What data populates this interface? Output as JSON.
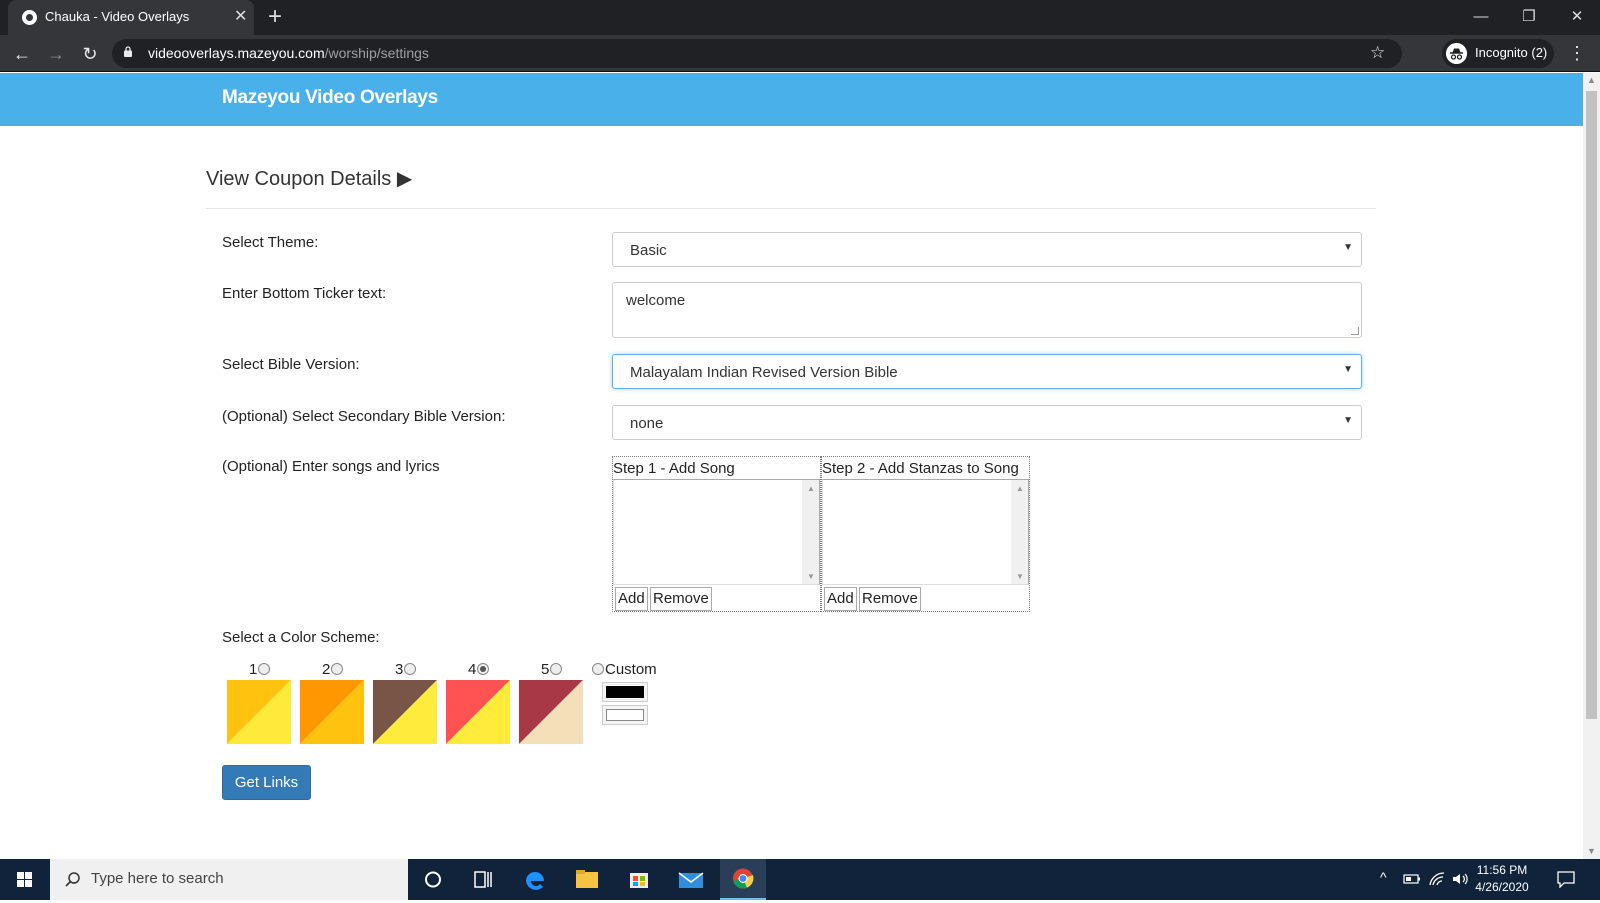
{
  "browser": {
    "tab_title": "Chauka - Video Overlays",
    "url_host": "videooverlays.mazeyou.com",
    "url_path": "/worship/settings",
    "profile_label": "Incognito (2)"
  },
  "page": {
    "brand": "Mazeyou Video Overlays",
    "coupon_link": "View Coupon Details",
    "coupon_arrow": "▶",
    "form": {
      "theme_label": "Select Theme:",
      "theme_value": "Basic",
      "ticker_label": "Enter Bottom Ticker text:",
      "ticker_value": "welcome",
      "bible_label": "Select Bible Version:",
      "bible_value": "Malayalam Indian Revised Version Bible",
      "secondary_label": "(Optional) Select Secondary Bible Version:",
      "secondary_value": "none",
      "songs_label": "(Optional) Enter songs and lyrics",
      "step1_caption": "Step 1 - Add Song",
      "step2_caption": "Step 2 - Add Stanzas to Song",
      "add_label": "Add",
      "remove_label": "Remove",
      "color_label": "Select a Color Scheme:",
      "schemes": [
        {
          "label": "1",
          "selected": false,
          "colors": [
            "#ffc20e",
            "#ffe93b"
          ]
        },
        {
          "label": "2",
          "selected": false,
          "colors": [
            "#ff9800",
            "#ffc20e"
          ]
        },
        {
          "label": "3",
          "selected": false,
          "colors": [
            "#795548",
            "#ffeb3b"
          ]
        },
        {
          "label": "4",
          "selected": true,
          "colors": [
            "#ff5252",
            "#ffeb3b"
          ]
        },
        {
          "label": "5",
          "selected": false,
          "colors": [
            "#a83845",
            "#f5dfb8"
          ]
        }
      ],
      "custom_label": "Custom",
      "custom_colors": [
        "#000000",
        "#ffffff"
      ],
      "submit_label": "Get Links"
    }
  },
  "taskbar": {
    "search_placeholder": "Type here to search",
    "time": "11:56 PM",
    "date": "4/26/2020"
  },
  "colors": {
    "header": "#4ab0ea",
    "primary_button": "#337ab7",
    "taskbar": "#10233a"
  }
}
